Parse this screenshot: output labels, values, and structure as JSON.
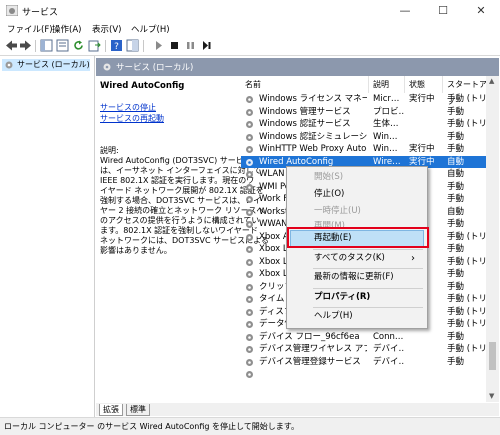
{
  "window": {
    "title": "サービス",
    "minimize": "—",
    "maximize": "☐",
    "close": "✕"
  },
  "menu": [
    "ファイル(F)",
    "操作(A)",
    "表示(V)",
    "ヘルプ(H)"
  ],
  "tree": {
    "item": "サービス (ローカル)"
  },
  "header": {
    "title": "サービス (ローカル)"
  },
  "description": {
    "service_name": "Wired AutoConfig",
    "stop_link": "サービスの停止",
    "restart_link": "サービスの再起動",
    "label": "説明:",
    "lines": [
      "Wired AutoConfig (DOT3SVC) サービス",
      "は、イーサネット インターフェイスに対して",
      "IEEE 802.1X 認証を実行します。現在のワ",
      "イヤード ネットワーク展開が 802.1X 認証を",
      "強制する場合、DOT3SVC サービスは、レイ",
      "ヤー 2 接続の確立とネットワーク リソースへ",
      "のアクセスの提供を行うように構成されてい",
      "ます。802.1X 認証を強制しないワイヤード",
      "ネットワークには、DOT3SVC サービスによる",
      "影響はありません。"
    ]
  },
  "columns": {
    "name": "名前",
    "desc": "説明",
    "state": "状態",
    "startup": "スタートアップ"
  },
  "rows": [
    {
      "name": "Windows ライセンス マネージャ…",
      "desc": "Micr…",
      "state": "実行中",
      "startup": "手動 (トリガ"
    },
    {
      "name": "Windows 管理サービス",
      "desc": "プロビ…",
      "state": "",
      "startup": "手動"
    },
    {
      "name": "Windows 認証サービス",
      "desc": "生体…",
      "state": "",
      "startup": "手動 (トリガ"
    },
    {
      "name": "Windows 認証シミュレーション…",
      "desc": "Win…",
      "state": "",
      "startup": "手動"
    },
    {
      "name": "WinHTTP Web Proxy Auto-…",
      "desc": "Win…",
      "state": "実行中",
      "startup": "手動"
    },
    {
      "name": "Wired AutoConfig",
      "desc": "Wire…",
      "state": "実行中",
      "startup": "自動"
    },
    {
      "name": "WLAN A",
      "desc": "",
      "state": "",
      "startup": "自動"
    },
    {
      "name": "WMI Pe",
      "desc": "",
      "state": "",
      "startup": "手動"
    },
    {
      "name": "Work Fo",
      "desc": "",
      "state": "",
      "startup": "手動"
    },
    {
      "name": "Workstat",
      "desc": "",
      "state": "",
      "startup": "自動"
    },
    {
      "name": "WWAN",
      "desc": "",
      "state": "",
      "startup": "手動"
    },
    {
      "name": "Xbox Ac",
      "desc": "",
      "state": "",
      "startup": "手動 (トリガ"
    },
    {
      "name": "Xbox Liv",
      "desc": "",
      "state": "",
      "startup": "手動"
    },
    {
      "name": "Xbox Liv",
      "desc": "",
      "state": "",
      "startup": "手動 (トリガ"
    },
    {
      "name": "Xbox Liv",
      "desc": "",
      "state": "",
      "startup": "手動"
    },
    {
      "name": "クリップボ",
      "desc": "",
      "state": "",
      "startup": "手動"
    },
    {
      "name": "タイム ゾー",
      "desc": "",
      "state": "",
      "startup": "手動 (トリガ"
    },
    {
      "name": "ディスプレ",
      "desc": "",
      "state": "",
      "startup": "手動 (トリガ"
    },
    {
      "name": "データ使用状況",
      "desc": "",
      "state": "",
      "startup": "手動 (トリガ"
    },
    {
      "name": "デバイス フロー_96cf6ea",
      "desc": "Conn…",
      "state": "",
      "startup": "手動"
    },
    {
      "name": "デバイス管理ワイヤレス アプリケ…",
      "desc": "デバイ…",
      "state": "",
      "startup": "手動 (トリガ"
    },
    {
      "name": "デバイス管理登録サービス",
      "desc": "デバイ…",
      "state": "",
      "startup": "手動"
    },
    {
      "name": "",
      "desc": "",
      "state": "",
      "startup": ""
    }
  ],
  "context_menu": [
    {
      "label": "開始(S)",
      "disabled": true
    },
    {
      "label": "停止(O)",
      "disabled": false
    },
    {
      "label": "一時停止(U)",
      "disabled": true
    },
    {
      "label": "再開(M)",
      "disabled": true
    },
    {
      "label": "再起動(E)",
      "disabled": false
    },
    {
      "label": "すべてのタスク(K)",
      "disabled": false,
      "arrow": "›"
    },
    {
      "label": "最新の情報に更新(F)",
      "disabled": false
    },
    {
      "label": "プロパティ(R)",
      "disabled": false,
      "bold": true
    },
    {
      "label": "ヘルプ(H)",
      "disabled": false
    }
  ],
  "tabs": {
    "extended": "拡張",
    "standard": "標準"
  },
  "status": "ローカル コンピューター のサービス Wired AutoConfig を停止して開始します。",
  "colors": {
    "selected": "#1e74d6",
    "header": "#8c98ad",
    "link": "#0033cc",
    "highlight": "#e3001b"
  }
}
